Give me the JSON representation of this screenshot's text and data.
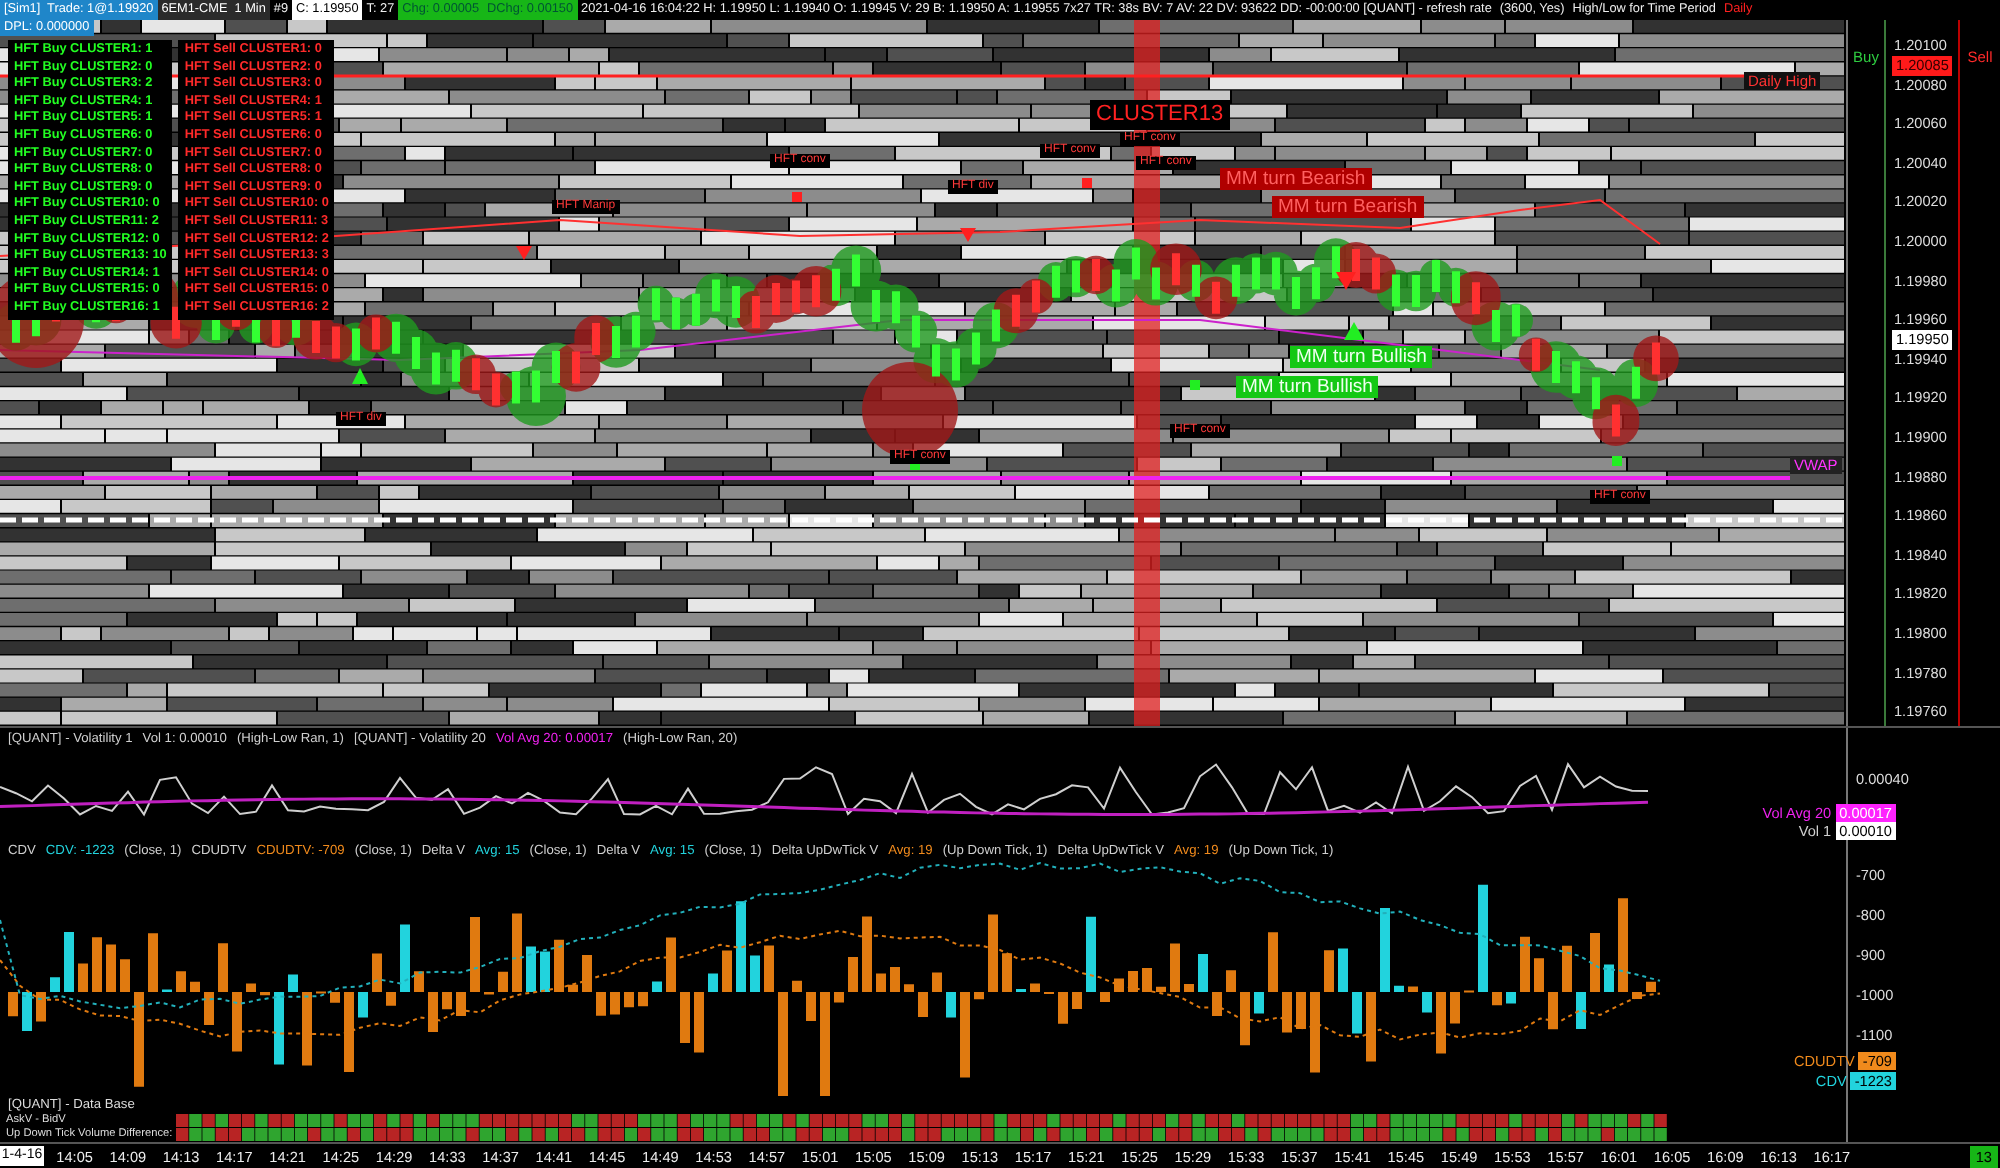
{
  "header": {
    "segments": [
      {
        "text": "[Sim1]  Trade: 1@1.19920",
        "kind": "account"
      },
      {
        "text": "6EM1-CME  1 Min",
        "kind": "instrument"
      },
      {
        "text": "#9",
        "kind": "info"
      },
      {
        "text": "C: 1.19950",
        "kind": "close"
      },
      {
        "text": "T: 27",
        "kind": "info"
      },
      {
        "text": "Chg: 0.00005",
        "kind": "change"
      },
      {
        "text": "DChg: 0.00150",
        "kind": "change"
      },
      {
        "text": "2021-04-16 16:04:22 H: 1.19950 L: 1.19940 O: 1.19945 V: 29 B: 1.19950 A: 1.19955 7x27 TR: 38s BV: 7 AV: 22 DV: 93622 DD: -00:00:00 [QUANT] - refresh rate",
        "kind": "info"
      },
      {
        "text": "(3600, Yes)",
        "kind": "info"
      },
      {
        "text": "High/Low for Time Period",
        "kind": "info"
      },
      {
        "text": "Daily",
        "kind": "alert"
      }
    ],
    "dpl": "DPL: 0.000000"
  },
  "clusters": {
    "buy": [
      "HFT Buy CLUSTER1: 1",
      "HFT Buy CLUSTER2: 0",
      "HFT Buy CLUSTER3: 2",
      "HFT Buy CLUSTER4: 1",
      "HFT Buy CLUSTER5: 1",
      "HFT Buy CLUSTER6: 0",
      "HFT Buy CLUSTER7: 0",
      "HFT Buy CLUSTER8: 0",
      "HFT Buy CLUSTER9: 0",
      "HFT Buy CLUSTER10: 0",
      "HFT Buy CLUSTER11: 2",
      "HFT Buy CLUSTER12: 0",
      "HFT Buy CLUSTER13: 10",
      "HFT Buy CLUSTER14: 1",
      "HFT Buy CLUSTER15: 0",
      "HFT Buy CLUSTER16: 1"
    ],
    "sell": [
      "HFT Sell CLUSTER1: 0",
      "HFT Sell CLUSTER2: 0",
      "HFT Sell CLUSTER3: 0",
      "HFT Sell CLUSTER4: 1",
      "HFT Sell CLUSTER5: 1",
      "HFT Sell CLUSTER6: 0",
      "HFT Sell CLUSTER7: 0",
      "HFT Sell CLUSTER8: 0",
      "HFT Sell CLUSTER9: 0",
      "HFT Sell CLUSTER10: 0",
      "HFT Sell CLUSTER11: 3",
      "HFT Sell CLUSTER12: 2",
      "HFT Sell CLUSTER13: 3",
      "HFT Sell CLUSTER14: 0",
      "HFT Sell CLUSTER15: 0",
      "HFT Sell CLUSTER16: 2"
    ]
  },
  "annotations": [
    {
      "text": "HFT Manip",
      "kind": "hft"
    },
    {
      "text": "HFT conv",
      "kind": "hft"
    },
    {
      "text": "HFT div",
      "kind": "hft"
    },
    {
      "text": "HFT conv",
      "kind": "hft"
    },
    {
      "text": "CLUSTER13",
      "kind": "cluster"
    },
    {
      "text": "HFT conv",
      "kind": "hft"
    },
    {
      "text": "HFT conv",
      "kind": "hft"
    },
    {
      "text": "MM turn Bearish",
      "kind": "bearish"
    },
    {
      "text": "MM turn Bearish",
      "kind": "bearish"
    },
    {
      "text": "MM turn Bullish",
      "kind": "bullish"
    },
    {
      "text": "MM turn Bullish",
      "kind": "bullish"
    },
    {
      "text": "HFT div",
      "kind": "hft"
    },
    {
      "text": "HFT conv",
      "kind": "hft"
    },
    {
      "text": "HFT conv",
      "kind": "hft"
    },
    {
      "text": "HFT conv",
      "kind": "hft"
    },
    {
      "text": "Daily High",
      "kind": "level"
    },
    {
      "text": "VWAP",
      "kind": "vwap"
    }
  ],
  "price_axis": {
    "buy_label": "Buy",
    "sell_label": "Sell",
    "ticks": [
      "1.20100",
      "1.20080",
      "1.20060",
      "1.20040",
      "1.20020",
      "1.20000",
      "1.19980",
      "1.19960",
      "1.19940",
      "1.19920",
      "1.19900",
      "1.19880",
      "1.19860",
      "1.19840",
      "1.19820",
      "1.19800",
      "1.19780",
      "1.19760"
    ],
    "markers": [
      {
        "text": "1.20085",
        "kind": "high"
      },
      {
        "text": "1.19950",
        "kind": "last"
      }
    ]
  },
  "volatility": {
    "legend": [
      {
        "text": "[QUANT] - Volatility 1",
        "kind": "plain"
      },
      {
        "text": "Vol 1: 0.00010",
        "kind": "plain"
      },
      {
        "text": "(High-Low Ran, 1)",
        "kind": "plain"
      },
      {
        "text": "[QUANT] - Volatility 20",
        "kind": "plain"
      },
      {
        "text": "Vol Avg 20: 0.00017",
        "kind": "magenta"
      },
      {
        "text": "(High-Low Ran, 20)",
        "kind": "plain"
      }
    ],
    "axis_ticks": [
      "0.00040"
    ],
    "labels": [
      {
        "name": "Vol Avg 20",
        "value": "0.00017",
        "kind": "magenta"
      },
      {
        "name": "Vol 1",
        "value": "0.00010",
        "kind": "plain"
      }
    ]
  },
  "delta": {
    "legend": [
      {
        "text": "CDV",
        "kind": "plain"
      },
      {
        "text": "CDV: -1223",
        "kind": "cyan"
      },
      {
        "text": "(Close, 1)",
        "kind": "plain"
      },
      {
        "text": "CDUDTV",
        "kind": "plain"
      },
      {
        "text": "CDUDTV: -709",
        "kind": "orange"
      },
      {
        "text": "(Close, 1)",
        "kind": "plain"
      },
      {
        "text": "Delta V",
        "kind": "plain"
      },
      {
        "text": "Avg: 15",
        "kind": "cyan"
      },
      {
        "text": "(Close, 1)",
        "kind": "plain"
      },
      {
        "text": "Delta V",
        "kind": "plain"
      },
      {
        "text": "Avg: 15",
        "kind": "cyan"
      },
      {
        "text": "(Close, 1)",
        "kind": "plain"
      },
      {
        "text": "Delta UpDwTick V",
        "kind": "plain"
      },
      {
        "text": "Avg: 19",
        "kind": "orange"
      },
      {
        "text": "(Up Down Tick, 1)",
        "kind": "plain"
      },
      {
        "text": "Delta UpDwTick V",
        "kind": "plain"
      },
      {
        "text": "Avg: 19",
        "kind": "orange"
      },
      {
        "text": "(Up Down Tick, 1)",
        "kind": "plain"
      }
    ],
    "axis_ticks": [
      "-700",
      "-800",
      "-900",
      "-1000",
      "-1100"
    ],
    "labels": [
      {
        "name": "CDUDTV",
        "value": "-709",
        "kind": "orange"
      },
      {
        "name": "CDV",
        "value": "-1223",
        "kind": "cyan"
      }
    ]
  },
  "database": {
    "title": "[QUANT] - Data Base",
    "rows": [
      "AskV - BidV",
      "Up Down Tick Volume Difference:"
    ]
  },
  "time_axis": {
    "date": "1-4-16",
    "ticks": [
      "14:05",
      "14:09",
      "14:13",
      "14:17",
      "14:21",
      "14:25",
      "14:29",
      "14:33",
      "14:37",
      "14:41",
      "14:45",
      "14:49",
      "14:53",
      "14:57",
      "15:01",
      "15:05",
      "15:09",
      "15:13",
      "15:17",
      "15:21",
      "15:25",
      "15:29",
      "15:33",
      "15:37",
      "15:41",
      "15:45",
      "15:49",
      "15:53",
      "15:57",
      "16:01",
      "16:05",
      "16:09",
      "16:13",
      "16:17"
    ],
    "badge": "13"
  }
}
